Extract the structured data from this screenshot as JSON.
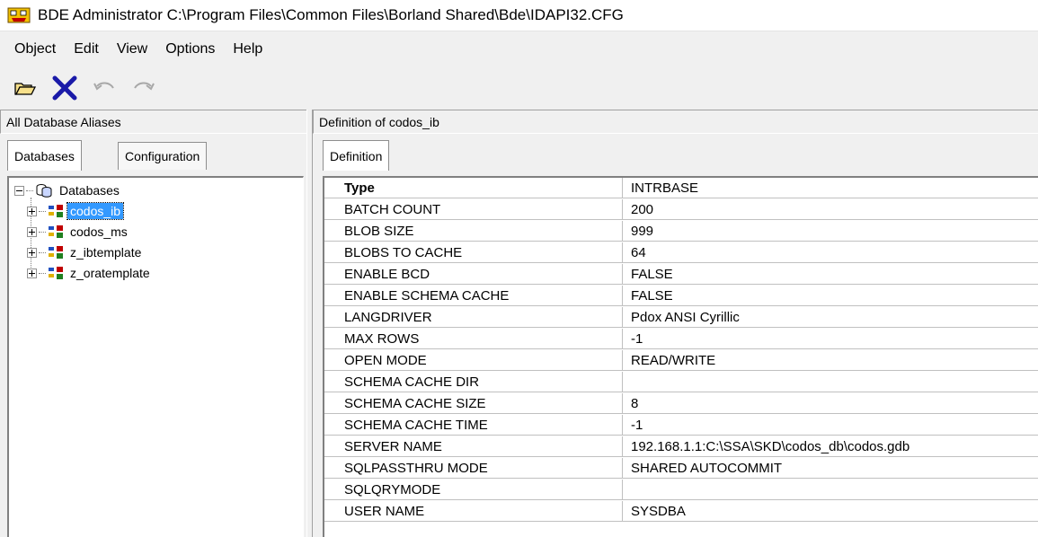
{
  "window": {
    "title": "BDE Administrator  C:\\Program Files\\Common Files\\Borland Shared\\Bde\\IDAPI32.CFG"
  },
  "menu": [
    "Object",
    "Edit",
    "View",
    "Options",
    "Help"
  ],
  "toolbar": {
    "icons": [
      "open-folder-icon",
      "delete-icon",
      "undo-icon",
      "redo-icon"
    ]
  },
  "left_panel": {
    "header": "All Database Aliases",
    "tabs": [
      "Databases",
      "Configuration"
    ],
    "tree": {
      "root": "Databases",
      "items": [
        "codos_ib",
        "codos_ms",
        "z_ibtemplate",
        "z_oratemplate"
      ],
      "selected": "codos_ib"
    }
  },
  "right_panel": {
    "header": "Definition of codos_ib",
    "tabs": [
      "Definition"
    ],
    "rows": [
      {
        "key": "Type",
        "value": "INTRBASE"
      },
      {
        "key": "BATCH COUNT",
        "value": "200"
      },
      {
        "key": "BLOB SIZE",
        "value": "999"
      },
      {
        "key": "BLOBS TO CACHE",
        "value": "64"
      },
      {
        "key": "ENABLE BCD",
        "value": "FALSE"
      },
      {
        "key": "ENABLE SCHEMA CACHE",
        "value": "FALSE"
      },
      {
        "key": "LANGDRIVER",
        "value": "Pdox ANSI Cyrillic"
      },
      {
        "key": "MAX ROWS",
        "value": "-1"
      },
      {
        "key": "OPEN MODE",
        "value": "READ/WRITE"
      },
      {
        "key": "SCHEMA CACHE DIR",
        "value": ""
      },
      {
        "key": "SCHEMA CACHE SIZE",
        "value": "8"
      },
      {
        "key": "SCHEMA CACHE TIME",
        "value": "-1"
      },
      {
        "key": "SERVER NAME",
        "value": "192.168.1.1:C:\\SSA\\SKD\\codos_db\\codos.gdb"
      },
      {
        "key": "SQLPASSTHRU MODE",
        "value": "SHARED AUTOCOMMIT"
      },
      {
        "key": "SQLQRYMODE",
        "value": ""
      },
      {
        "key": "USER NAME",
        "value": "SYSDBA"
      }
    ]
  }
}
